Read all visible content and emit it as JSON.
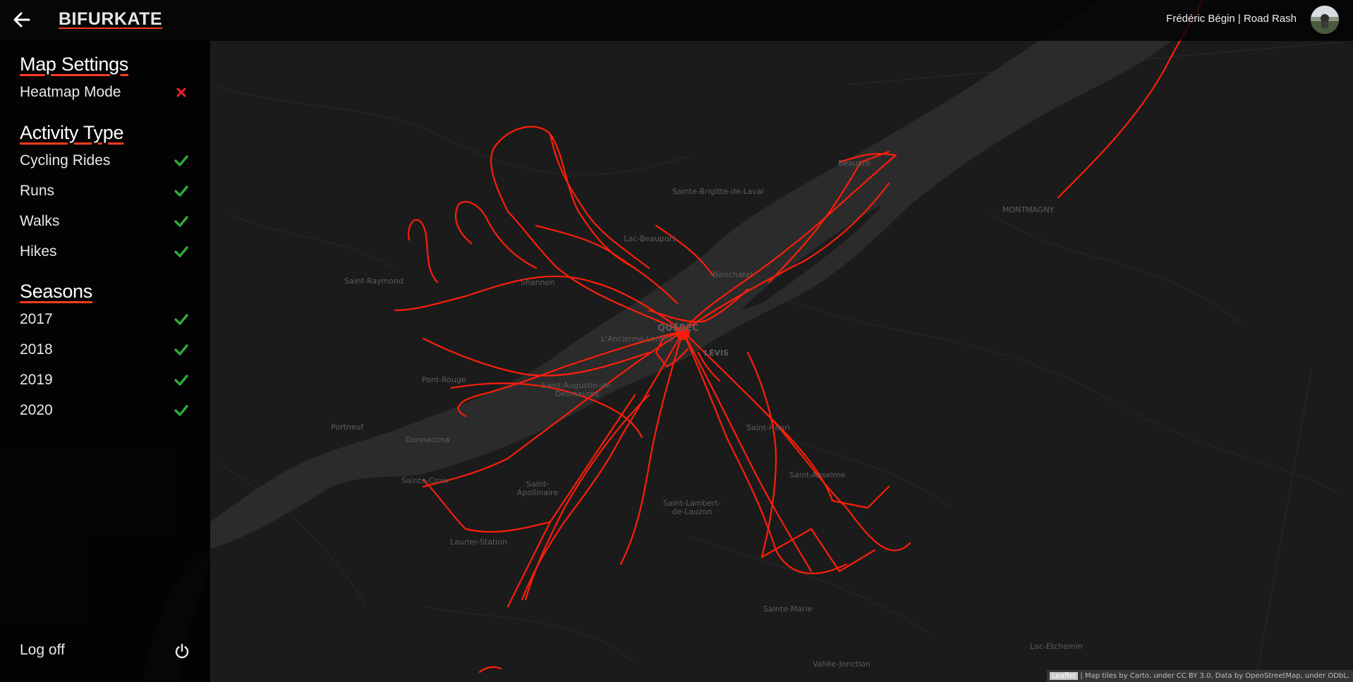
{
  "header": {
    "back_icon": "arrow-left-icon",
    "brand": "BIFURKATE",
    "user_label": "Frédéric Bégin | Road Rash"
  },
  "sidebar": {
    "map_settings": {
      "title": "Map Settings",
      "items": [
        {
          "label": "Heatmap Mode",
          "enabled": false,
          "icon": "cross-icon"
        }
      ]
    },
    "activity_type": {
      "title": "Activity Type",
      "items": [
        {
          "label": "Cycling Rides",
          "enabled": true,
          "icon": "check-icon"
        },
        {
          "label": "Runs",
          "enabled": true,
          "icon": "check-icon"
        },
        {
          "label": "Walks",
          "enabled": true,
          "icon": "check-icon"
        },
        {
          "label": "Hikes",
          "enabled": true,
          "icon": "check-icon"
        }
      ]
    },
    "seasons": {
      "title": "Seasons",
      "items": [
        {
          "label": "2017",
          "enabled": true,
          "icon": "check-icon"
        },
        {
          "label": "2018",
          "enabled": true,
          "icon": "check-icon"
        },
        {
          "label": "2019",
          "enabled": true,
          "icon": "check-icon"
        },
        {
          "label": "2020",
          "enabled": true,
          "icon": "check-icon"
        }
      ]
    },
    "logoff": {
      "label": "Log off",
      "icon": "power-icon"
    }
  },
  "map": {
    "places": [
      "Sainte-Brigitte-de-Laval",
      "Lac-Beauport",
      "Beaupré",
      "MONTMAGNY",
      "Saint-Raymond",
      "Shannon",
      "Boischatel",
      "QUÉBEC",
      "L'Ancienne-Lorette",
      "LÉVIS",
      "Pont-Rouge",
      "Saint-Augustin-de-Desmaures",
      "Portneuf",
      "Donnacona",
      "Saint-Henri",
      "Sainte-Croix",
      "Saint-Apollinaire",
      "Saint-Anselme",
      "Saint-Lambert-de-Lauzon",
      "Laurier-Station",
      "Sainte-Marie",
      "Lac-Etchemin",
      "Vallée-Jonction"
    ],
    "attribution_leaflet": "Leaflet",
    "attribution_text": " | Map tiles by Carto, under CC BY 3.0. Data by OpenStreetMap, under ODbL.",
    "route_color": "#ff1e0a",
    "water_color": "#2b2b2b"
  },
  "colors": {
    "accent_underline": "#ff3b1f",
    "check": "#2eab3a",
    "cross": "#e8202a"
  }
}
